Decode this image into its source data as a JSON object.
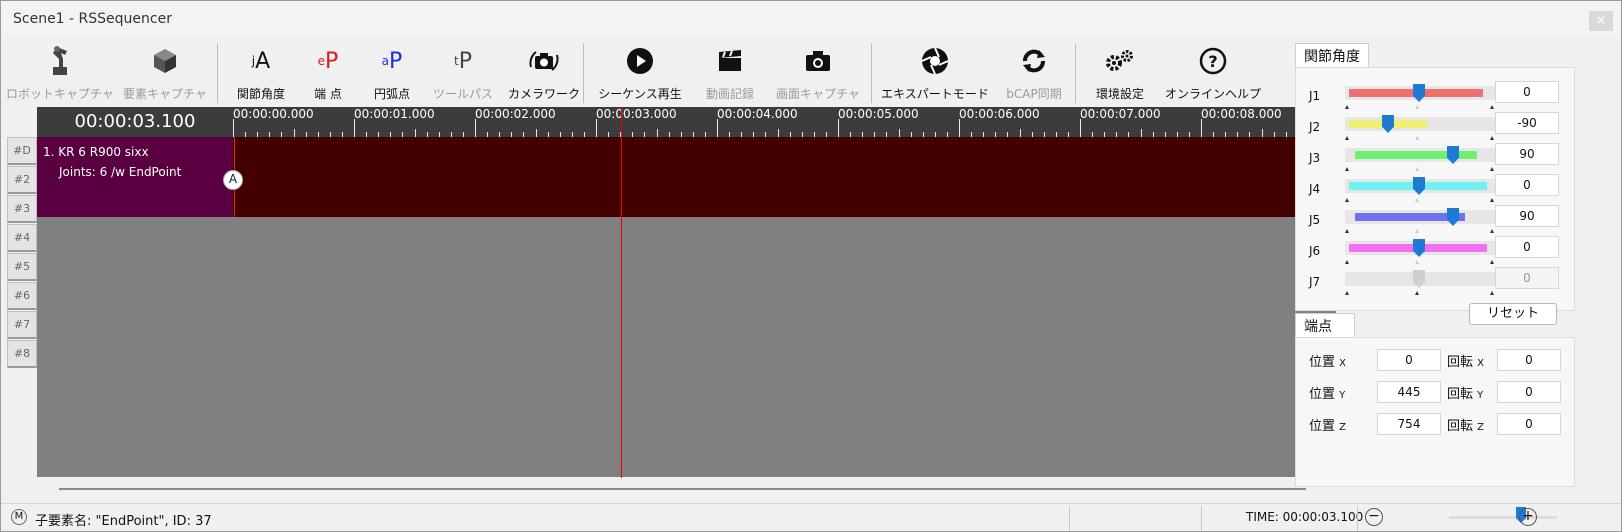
{
  "window": {
    "title": "Scene1 - RSSequencer",
    "close_glyph": "×"
  },
  "toolbar": {
    "robot_capture": "ロボットキャプチャ",
    "element_capture": "要素キャプチャ",
    "joint_angle": "関節角度",
    "end_point": "端 点",
    "arc_point": "円弧点",
    "tool_path": "ツールパス",
    "camera_work": "カメラワーク",
    "sequence_play": "シーケンス再生",
    "video_record": "動画記録",
    "screen_capture": "画面キャプチャ",
    "expert_mode": "エキスパートモード",
    "bcap_sync": "bCAP同期",
    "env_settings": "環境設定",
    "online_help": "オンラインヘルプ",
    "icon_letters": {
      "ja_pfx": "j",
      "ja": "A",
      "ep_pfx": "e",
      "ep": "P",
      "ap_pfx": "a",
      "ap": "P",
      "tp_pfx": "t",
      "tp": "P"
    }
  },
  "timeline": {
    "current_time": "00:00:03.100",
    "ruler_labels": [
      "00:00:00.000",
      "00:00:01.000",
      "00:00:02.000",
      "00:00:03.000",
      "00:00:04.000",
      "00:00:05.000",
      "00:00:06.000",
      "00:00:07.000",
      "00:00:08.000"
    ],
    "track_tabs": [
      "#D",
      "#2",
      "#3",
      "#4",
      "#5",
      "#6",
      "#7",
      "#8"
    ],
    "track1": {
      "title": "1.  KR 6 R900 sixx",
      "subtitle": "Joints: 6 /w EndPoint",
      "key_label": "A"
    }
  },
  "joint_panel": {
    "tab": "関節角度",
    "joints": [
      {
        "name": "J1",
        "value": "0",
        "color": "#f07070"
      },
      {
        "name": "J2",
        "value": "-90",
        "color": "#f0f070"
      },
      {
        "name": "J3",
        "value": "90",
        "color": "#70f070"
      },
      {
        "name": "J4",
        "value": "0",
        "color": "#70f0f0"
      },
      {
        "name": "J5",
        "value": "90",
        "color": "#7070f0"
      },
      {
        "name": "J6",
        "value": "0",
        "color": "#f070f0"
      },
      {
        "name": "J7",
        "value": "0",
        "color": "#cccccc"
      }
    ],
    "reset_label": "リセット"
  },
  "endpoint_panel": {
    "tab": "端点",
    "pos_label": "位置",
    "rot_label": "回転",
    "axes": [
      "X",
      "Y",
      "Z"
    ],
    "pos_values": [
      "0",
      "445",
      "754"
    ],
    "rot_values": [
      "0",
      "0",
      "0"
    ]
  },
  "status": {
    "mode_icon": "M",
    "message": "子要素名: \"EndPoint\", ID: 37",
    "time": "TIME: 00:00:03.100",
    "zoom_out": "−",
    "zoom_in": "+"
  }
}
